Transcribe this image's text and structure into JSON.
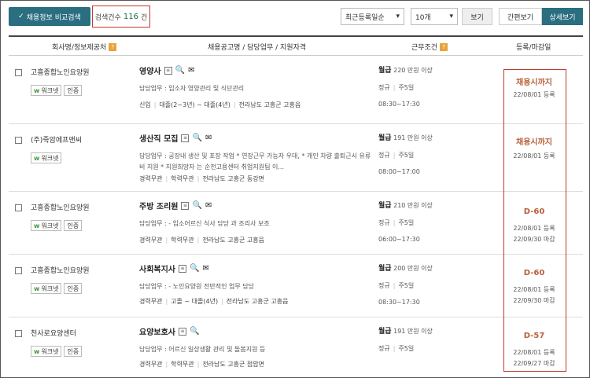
{
  "toolbar": {
    "compare_label": "채용정보 비교검색",
    "count_label": "검색건수",
    "count_value": "116",
    "count_unit": "건",
    "sort_select": "최근등록일순",
    "per_page_select": "10개",
    "view_label": "보기",
    "simple_view": "간편보기",
    "detail_view": "상세보기"
  },
  "header": {
    "col_company": "회사명/정보제공처",
    "col_title": "채용공고명 / 담당업무 / 지원자격",
    "col_cond": "근무조건",
    "col_date": "등록/마감일",
    "help": "?"
  },
  "badges": {
    "worknet": "워크넷",
    "certified": "인증",
    "worknet_mark": "w"
  },
  "rows": [
    {
      "company": "고흥종합노인요양원",
      "title": "영양사",
      "duty": "담당업무 : 입소자 영양관리 및 식단관리",
      "cond": [
        "신입",
        "대졸(2~3년) ~ 대졸(4년)",
        "전라남도 고흥군 고흥읍"
      ],
      "wage_label": "월급",
      "wage": "220 만원 이상",
      "emp": "정규",
      "days": "주5일",
      "hours": "08:30~17:30",
      "deadline": "채용시까지",
      "reg": "22/08/01 등록",
      "close": ""
    },
    {
      "company": "(주)죽암에프앤씨",
      "title": "생산직 모집",
      "duty": "담당업무 : 공장내 생산 및 포장 작업 * 연장근무 가능자 우대, * 개인 차량 출퇴근시 유류비 지원 * 지원희망자 는 순천고용센터 취업지원팀 이...",
      "cond": [
        "경력무관",
        "학력무관",
        "전라남도 고흥군 동강면"
      ],
      "wage_label": "월급",
      "wage": "191 만원 이상",
      "emp": "정규",
      "days": "주5일",
      "hours": "08:00~17:00",
      "deadline": "채용시까지",
      "reg": "22/08/01 등록",
      "close": ""
    },
    {
      "company": "고흥종합노인요양원",
      "title": "주방 조리원",
      "duty": "담당업무 : - 입소어르신 식사 담당 과 조리사 보조",
      "cond": [
        "경력무관",
        "학력무관",
        "전라남도 고흥군 고흥읍"
      ],
      "wage_label": "월급",
      "wage": "210 만원 이상",
      "emp": "정규",
      "days": "주5일",
      "hours": "06:00~17:30",
      "deadline": "D-60",
      "reg": "22/08/01 등록",
      "close": "22/09/30 마감"
    },
    {
      "company": "고흥종합노인요양원",
      "title": "사회복지사",
      "duty": "담당업무 : - 노인요양원 전반적인 업무 담당",
      "cond": [
        "경력무관",
        "고졸 ~ 대졸(4년)",
        "전라남도 고흥군 고흥읍"
      ],
      "wage_label": "월급",
      "wage": "200 만원 이상",
      "emp": "정규",
      "days": "주5일",
      "hours": "08:30~17:30",
      "deadline": "D-60",
      "reg": "22/08/01 등록",
      "close": "22/09/30 마감"
    },
    {
      "company": "천사로요양센터",
      "title": "요양보호사",
      "duty": "담당업무 : 어르신 일상생활 관리 및 돌봄지원 등",
      "cond": [
        "경력무관",
        "학력무관",
        "전라남도 고흥군 점암면"
      ],
      "wage_label": "월급",
      "wage": "191 만원 이상",
      "emp": "정규",
      "days": "주5일",
      "hours": "",
      "deadline": "D-57",
      "reg": "22/08/01 등록",
      "close": "22/09/27 마감"
    }
  ]
}
